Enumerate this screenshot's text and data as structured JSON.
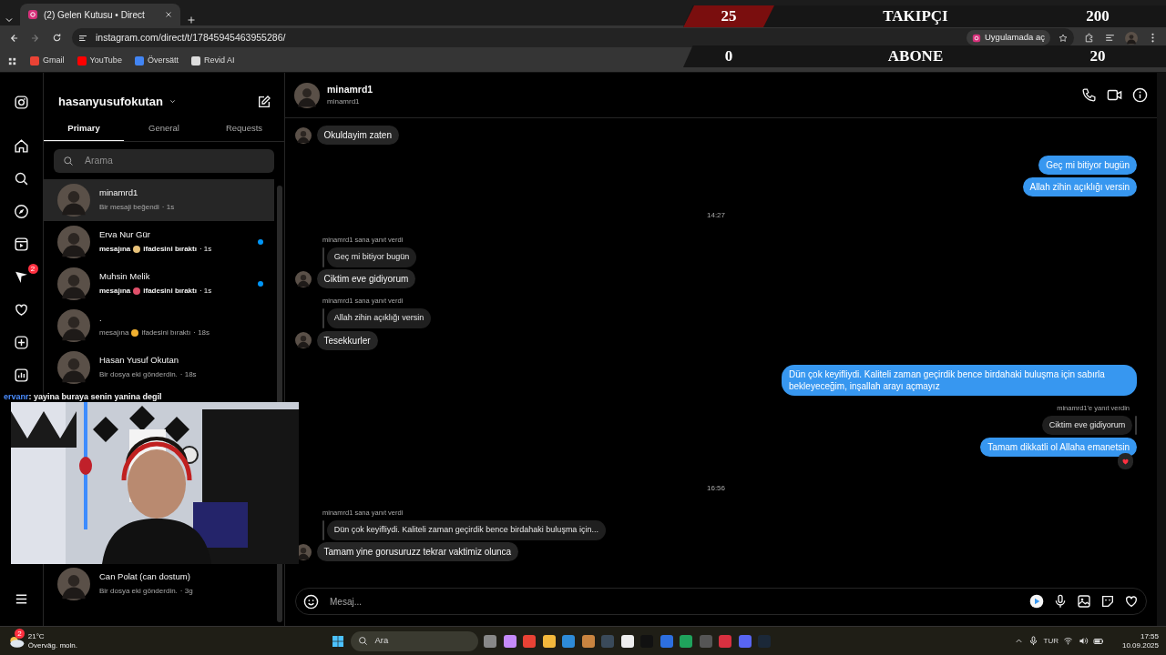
{
  "browser": {
    "tab_title": "(2) Gelen Kutusu • Direct",
    "url": "instagram.com/direct/t/17845945463955286/",
    "open_in_app": "Uygulamada aç",
    "bookmarks": [
      "Gmail",
      "YouTube",
      "Översätt",
      "Revid AI"
    ]
  },
  "stream_overlay": {
    "counters": [
      {
        "current": "25",
        "label": "TAKIPÇI",
        "goal": "200",
        "highlight": true
      },
      {
        "current": "0",
        "label": "ABONE",
        "goal": "20",
        "highlight": false
      }
    ],
    "chat": {
      "user": "ervanr",
      "text": ": yayina buraya senin yanina degil"
    }
  },
  "rail": {
    "messages_badge": "2"
  },
  "inbox": {
    "account": "hasanyusufokutan",
    "tabs": [
      {
        "label": "Primary",
        "selected": true
      },
      {
        "label": "General",
        "selected": false
      },
      {
        "label": "Requests",
        "selected": false
      }
    ],
    "search_placeholder": "Arama",
    "threads": [
      {
        "name": "minamrd1",
        "preview": "Bir mesaji beğendi",
        "time": "· 1s",
        "selected": true,
        "unread": false
      },
      {
        "name": "Erva Nur Gür",
        "preview": "mesajına",
        "reaction": {
          "color": "#e8c27a"
        },
        "preview_after": "ifadesini bıraktı",
        "time": "· 1s",
        "selected": false,
        "unread": true
      },
      {
        "name": "Muhsin Melik",
        "preview": "mesajına",
        "reaction": {
          "color": "#e0506a"
        },
        "preview_after": "ifadesini bıraktı",
        "time": "· 1s",
        "selected": false,
        "unread": true
      },
      {
        "name": ".",
        "preview": "mesajına",
        "reaction": {
          "color": "#f0b030"
        },
        "preview_after": "ifadesini bıraktı",
        "time": "· 18s",
        "selected": false,
        "unread": false
      },
      {
        "name": "Hasan Yusuf Okutan",
        "preview": "Bir dosya eki gönderdin.",
        "time": "· 18s",
        "selected": false,
        "unread": false
      },
      {
        "name": "Can Polat (can dostum)",
        "preview": "Bir dosya eki gönderdin.",
        "time": "· 3g",
        "selected": false,
        "unread": false
      }
    ]
  },
  "chat": {
    "name": "minamrd1",
    "username": "minamrd1",
    "composer_placeholder": "Mesaj...",
    "messages": [
      {
        "kind": "in",
        "text": "Okuldayim zaten"
      },
      {
        "kind": "out",
        "text": "Geç mi bitiyor bugün",
        "liked": false
      },
      {
        "kind": "out",
        "text": "Allah zihin açıklığı versin",
        "liked": false
      },
      {
        "kind": "time",
        "text": "14:27"
      },
      {
        "kind": "in",
        "reply_note": "minamrd1 sana yanıt verdi",
        "quoted": "Geç mi bitiyor bugün",
        "text": "Ciktim eve gidiyorum"
      },
      {
        "kind": "in",
        "reply_note": "minamrd1 sana yanıt verdi",
        "quoted": "Allah zihin açıklığı versin",
        "text": "Tesekkurler"
      },
      {
        "kind": "out",
        "text": "Dün çok keyifliydi. Kaliteli zaman geçirdik bence birdahaki buluşma için sabırla bekleyeceğim, inşallah arayı açmayız",
        "liked": false
      },
      {
        "kind": "out",
        "reply_note": "minamrd1'e yanıt verdin",
        "quoted": "Ciktim eve gidiyorum",
        "text": "Tamam dikkatli ol Allaha emanetsin",
        "liked": true
      },
      {
        "kind": "time",
        "text": "16:56"
      },
      {
        "kind": "in",
        "reply_note": "minamrd1 sana yanıt verdi",
        "quoted": "Dün çok keyifliydi. Kaliteli zaman geçirdik bence birdahaki buluşma için...",
        "text": "Tamam yine gorusuruzz tekrar vaktimiz olunca"
      }
    ]
  },
  "taskbar": {
    "weather_badge": "2",
    "temperature": "21°C",
    "condition": "Överväg. moln.",
    "search": "Ara",
    "language": "TUR",
    "time": "17:55",
    "date": "10.09.2025"
  }
}
